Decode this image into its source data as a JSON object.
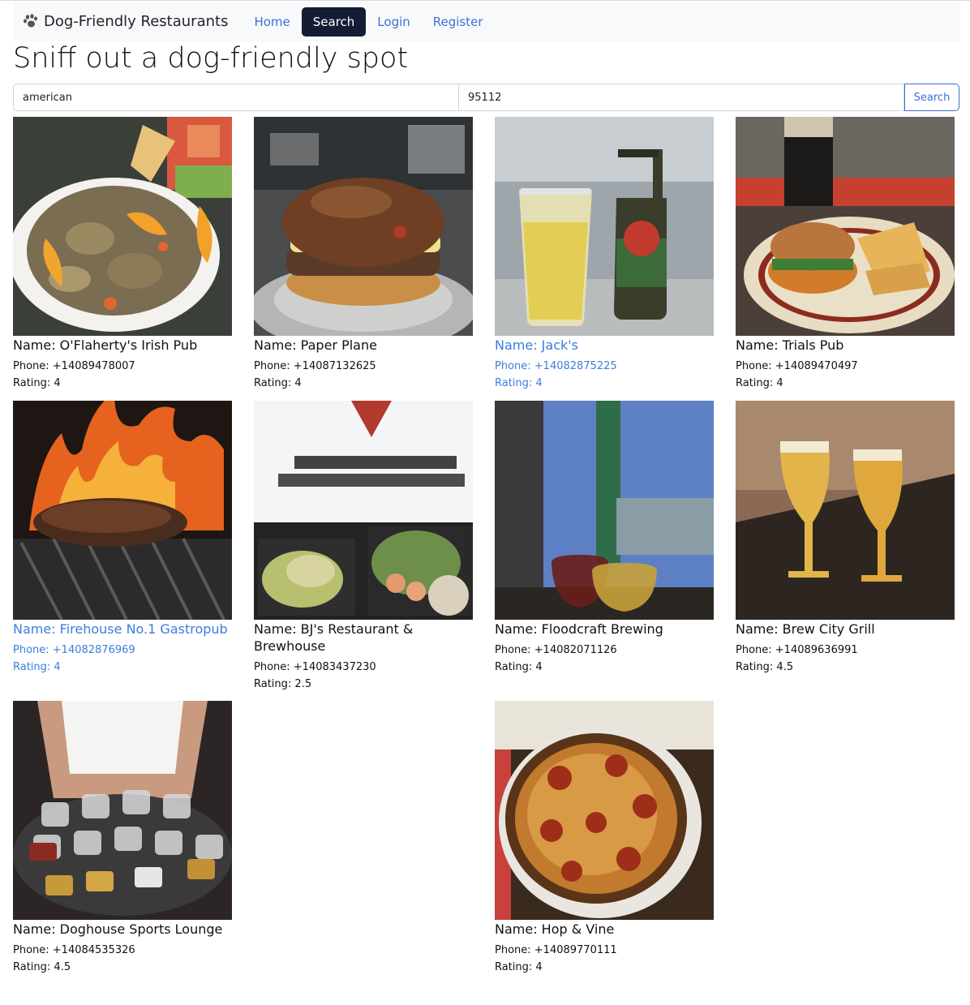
{
  "navbar": {
    "brand": "Dog-Friendly Restaurants",
    "brand_icon": "paw-icon",
    "links": [
      {
        "label": "Home",
        "active": false
      },
      {
        "label": "Search",
        "active": true
      },
      {
        "label": "Login",
        "active": false
      },
      {
        "label": "Register",
        "active": false
      }
    ]
  },
  "headline": "Sniff out a dog-friendly spot",
  "search": {
    "term_value": "american",
    "location_value": "95112",
    "button_label": "Search"
  },
  "colors": {
    "accent": "#3b6fd8",
    "nav_active_bg": "#131c33",
    "highlight_text": "#3b7ddd"
  },
  "restaurants": [
    {
      "name": "Name: O'Flaherty's Irish Pub",
      "phone": "Phone: +14089478007",
      "rating": "Rating: 4",
      "highlighted": false,
      "photo": "chicken-salad-photo"
    },
    {
      "name": "Name: Paper Plane",
      "phone": "Phone: +14087132625",
      "rating": "Rating: 4",
      "highlighted": false,
      "photo": "burger-photo"
    },
    {
      "name": "Name: Jack's",
      "phone": "Phone: +14082875225",
      "rating": "Rating: 4",
      "highlighted": true,
      "photo": "beer-bottle-photo"
    },
    {
      "name": "Name: Trials Pub",
      "phone": "Phone: +14089470497",
      "rating": "Rating: 4",
      "highlighted": false,
      "photo": "burger-fries-photo"
    },
    {
      "name": "Name: Firehouse No.1 Gastropub",
      "phone": "Phone: +14082876969",
      "rating": "Rating: 4",
      "highlighted": true,
      "photo": "grilled-steak-photo"
    },
    {
      "name": "Name: BJ's Restaurant & Brewhouse",
      "phone": "Phone: +14083437230",
      "rating": "Rating: 2.5",
      "highlighted": false,
      "photo": "delivery-bag-photo"
    },
    {
      "name": "Name: Floodcraft Brewing",
      "phone": "Phone: +14082071126",
      "rating": "Rating: 4",
      "highlighted": false,
      "photo": "beer-flight-photo"
    },
    {
      "name": "Name: Brew City Grill",
      "phone": "Phone: +14089636991",
      "rating": "Rating: 4.5",
      "highlighted": false,
      "photo": "two-beers-photo"
    },
    {
      "name": "Name: Doghouse Sports Lounge",
      "phone": "Phone: +14084535326",
      "rating": "Rating: 4.5",
      "highlighted": false,
      "photo": "shot-glasses-photo"
    },
    {
      "name": "Name: Hop & Vine",
      "phone": "Phone: +14089770111",
      "rating": "Rating: 4",
      "highlighted": false,
      "photo": "pepperoni-pizza-photo"
    }
  ]
}
